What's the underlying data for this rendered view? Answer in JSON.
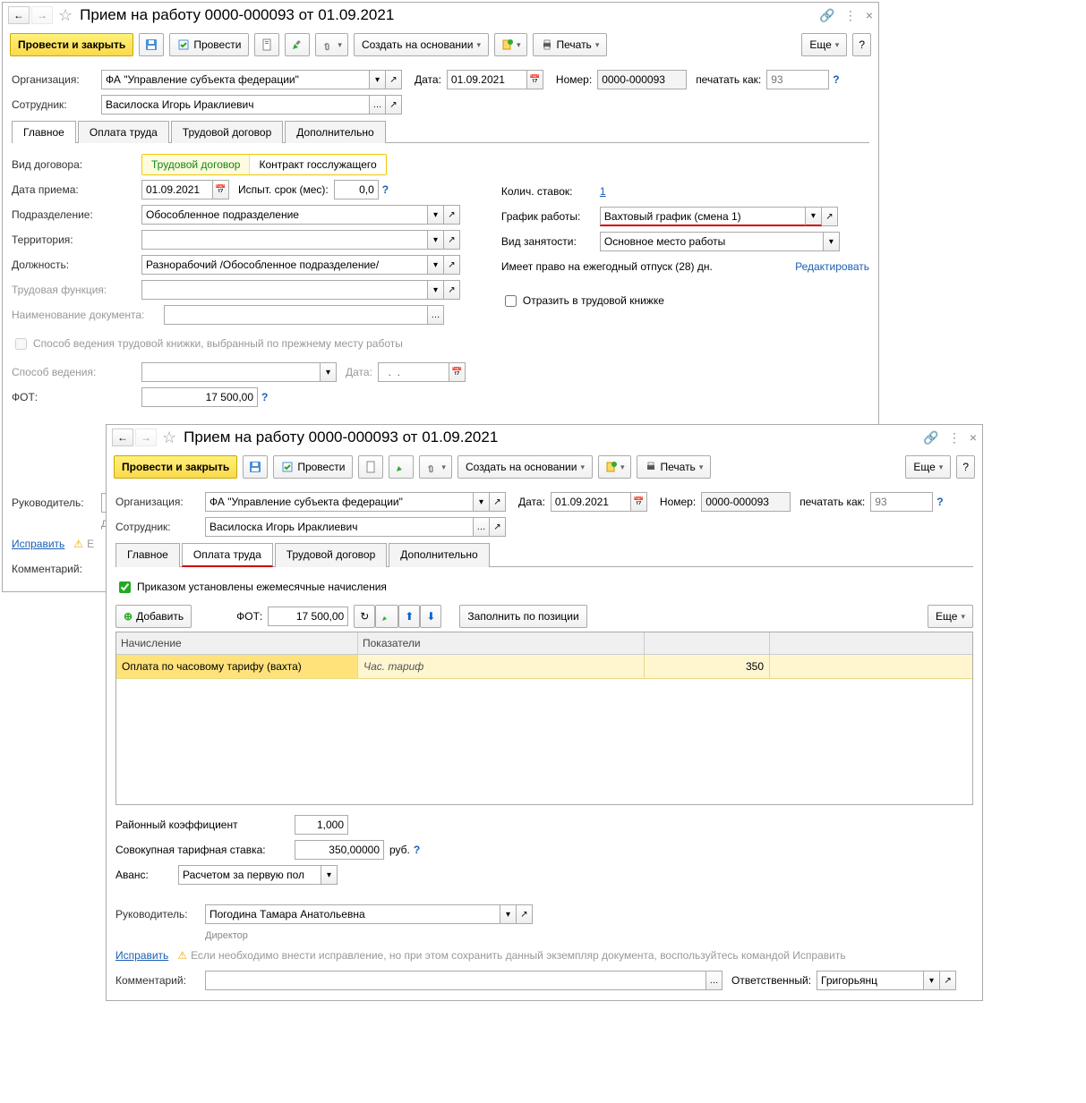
{
  "w1": {
    "title": "Прием на работу 0000-000093 от 01.09.2021",
    "toolbar": {
      "post_close": "Провести и закрыть",
      "post": "Провести",
      "create_base": "Создать на основании",
      "print": "Печать",
      "more": "Еще"
    },
    "header": {
      "org_lbl": "Организация:",
      "org_val": "ФА \"Управление субъекта федерации\"",
      "date_lbl": "Дата:",
      "date_val": "01.09.2021",
      "num_lbl": "Номер:",
      "num_val": "0000-000093",
      "printas_lbl": "печатать как:",
      "printas_ph": "93",
      "emp_lbl": "Сотрудник:",
      "emp_val": "Василоска Игорь Ираклиевич"
    },
    "tabs": {
      "t1": "Главное",
      "t2": "Оплата труда",
      "t3": "Трудовой договор",
      "t4": "Дополнительно"
    },
    "main": {
      "kind_lbl": "Вид договора:",
      "kind_a": "Трудовой договор",
      "kind_b": "Контракт госслужащего",
      "hiredate_lbl": "Дата приема:",
      "hiredate_val": "01.09.2021",
      "trial_lbl": "Испыт. срок (мес):",
      "trial_val": "0,0",
      "dept_lbl": "Подразделение:",
      "dept_val": "Обособленное подразделение",
      "terr_lbl": "Территория:",
      "pos_lbl": "Должность:",
      "pos_val": "Разнорабочий /Обособленное подразделение/",
      "func_lbl": "Трудовая функция:",
      "docname_lbl": "Наименование документа:",
      "bookway_chk": "Способ ведения трудовой книжки, выбранный по прежнему месту работы",
      "bookway_lbl": "Способ ведения:",
      "date2_lbl": "Дата:",
      "date2_val": "  .  .    ",
      "fot_lbl": "ФОТ:",
      "fot_val": "17 500,00",
      "rates_lbl": "Колич. ставок:",
      "rates_val": "1",
      "sched_lbl": "График работы:",
      "sched_val": "Вахтовый график (смена 1)",
      "emptype_lbl": "Вид занятости:",
      "emptype_val": "Основное место работы",
      "vacation_txt": "Имеет право на ежегодный отпуск (28) дн.",
      "vacation_link": "Редактировать",
      "reflect_chk": "Отразить в трудовой книжке"
    },
    "footer": {
      "boss_lbl": "Руководитель:",
      "boss_hint": "Дир",
      "fix_link": "Исправить",
      "warn_pref": "Е",
      "comment_lbl": "Комментарий:"
    }
  },
  "w2": {
    "title": "Прием на работу 0000-000093 от 01.09.2021",
    "toolbar": {
      "post_close": "Провести и закрыть",
      "post": "Провести",
      "create_base": "Создать на основании",
      "print": "Печать",
      "more": "Еще"
    },
    "header": {
      "org_lbl": "Организация:",
      "org_val": "ФА \"Управление субъекта федерации\"",
      "date_lbl": "Дата:",
      "date_val": "01.09.2021",
      "num_lbl": "Номер:",
      "num_val": "0000-000093",
      "printas_lbl": "печатать как:",
      "printas_ph": "93",
      "emp_lbl": "Сотрудник:",
      "emp_val": "Василоска Игорь Ираклиевич"
    },
    "tabs": {
      "t1": "Главное",
      "t2": "Оплата труда",
      "t3": "Трудовой договор",
      "t4": "Дополнительно"
    },
    "pay": {
      "chk_monthly": "Приказом установлены ежемесячные начисления",
      "add_btn": "Добавить",
      "fot_lbl": "ФОТ:",
      "fot_val": "17 500,00",
      "fill_btn": "Заполнить по позиции",
      "more": "Еще",
      "th1": "Начисление",
      "th2": "Показатели",
      "row_name": "Оплата по часовому тарифу (вахта)",
      "row_ind": "Час. тариф",
      "row_val": "350",
      "coef_lbl": "Районный коэффициент",
      "coef_val": "1,000",
      "rate_lbl": "Совокупная тарифная ставка:",
      "rate_val": "350,00000",
      "rate_unit": "руб.",
      "advance_lbl": "Аванс:",
      "advance_val": "Расчетом за первую пол"
    },
    "footer": {
      "boss_lbl": "Руководитель:",
      "boss_val": "Погодина Тамара Анатольевна",
      "boss_hint": "Директор",
      "fix_link": "Исправить",
      "warn_txt": "Если необходимо внести исправление, но при этом сохранить данный экземпляр документа, воспользуйтесь командой Исправить",
      "comment_lbl": "Комментарий:",
      "resp_lbl": "Ответственный:",
      "resp_val": "Григорьянц"
    }
  }
}
